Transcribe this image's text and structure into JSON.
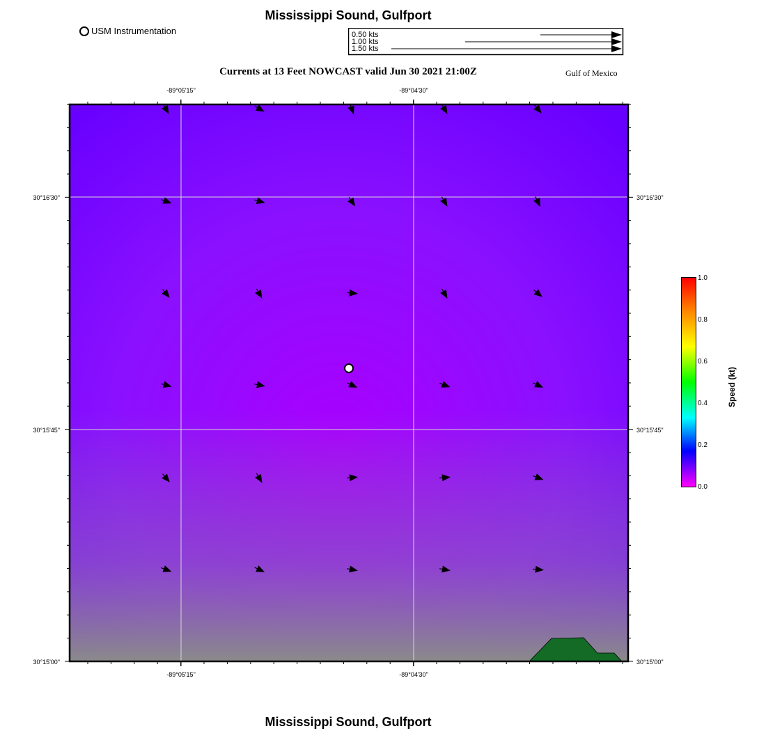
{
  "title_top": "Mississippi Sound, Gulfport",
  "title_bottom": "Mississippi Sound, Gulfport",
  "subtitle": "Currents at 13 Feet NOWCAST valid Jun 30 2021 21:00Z",
  "region_label": "Gulf of Mexico",
  "station_legend": {
    "label": "USM Instrumentation",
    "icon": "circle-marker-icon"
  },
  "arrow_legend": [
    {
      "label": "0.50 kts",
      "speed": 0.5
    },
    {
      "label": "1.00 kts",
      "speed": 1.0
    },
    {
      "label": "1.50 kts",
      "speed": 1.5
    }
  ],
  "axes": {
    "x_ticks_top": [
      "-89°05'15\"",
      "-89°04'30\""
    ],
    "x_ticks_bottom": [
      "-89°05'15\"",
      "-89°04'30\""
    ],
    "y_ticks_left": [
      "30°16'30\"",
      "30°15'45\"",
      "30°15'00\""
    ],
    "y_ticks_right": [
      "30°16'30\"",
      "30°15'45\"",
      "30°15'00\""
    ]
  },
  "colorbar": {
    "label": "Speed (kt)",
    "ticks": [
      "1.0",
      "0.8",
      "0.6",
      "0.4",
      "0.2",
      "0.0"
    ],
    "colors": [
      "#ff0000",
      "#ff7f00",
      "#ffff00",
      "#00ff00",
      "#00ffff",
      "#0000ff",
      "#ff00ff"
    ]
  },
  "colors": {
    "water_upper": "#6a00ff",
    "water_center": "#a800ff",
    "water_lower": "#8c7aa0",
    "land": "#146b26",
    "grid": "#d8d8d8"
  },
  "current_vectors": {
    "direction_deg_from_north": [
      [
        150,
        120,
        160,
        150,
        140
      ],
      [
        110,
        105,
        145,
        150,
        155
      ],
      [
        140,
        150,
        95,
        150,
        130
      ],
      [
        105,
        100,
        115,
        110,
        115
      ],
      [
        140,
        150,
        85,
        85,
        110
      ],
      [
        110,
        115,
        100,
        100,
        95
      ]
    ]
  }
}
